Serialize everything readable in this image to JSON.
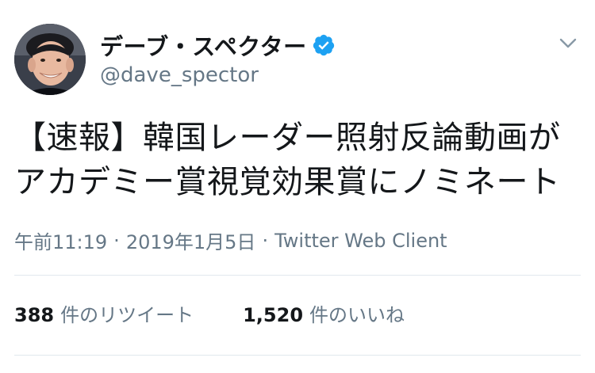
{
  "user": {
    "display_name": "デーブ・スペクター",
    "handle": "@dave_spector",
    "verified": true
  },
  "tweet": {
    "text": "【速報】韓国レーダー照射反論動画が\nアカデミー賞視覚効果賞にノミネート"
  },
  "meta": {
    "time": "午前11:19",
    "separator": "·",
    "date": "2019年1月5日",
    "source": "Twitter Web Client"
  },
  "stats": {
    "retweets_count": "388",
    "retweets_label": "件のリツイート",
    "likes_count": "1,520",
    "likes_label": "件のいいね"
  },
  "colors": {
    "verified_blue": "#1da1f2",
    "secondary_text": "#657786",
    "divider": "#e1e8ed"
  },
  "icons": {
    "verified": "verified-badge-icon",
    "menu": "chevron-down-icon"
  }
}
